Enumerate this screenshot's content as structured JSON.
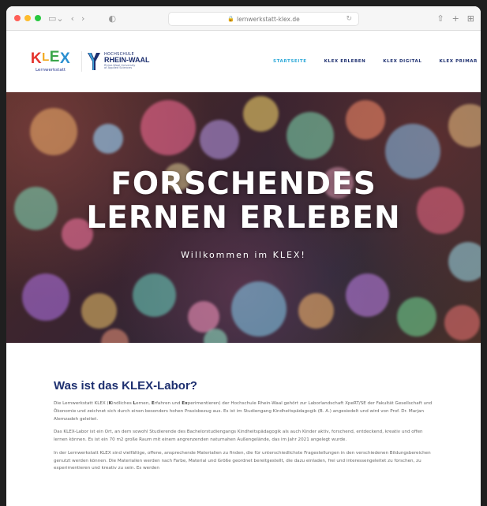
{
  "browser": {
    "url": "lernwerkstatt-klex.de",
    "traffic_lights": [
      "#ff5f57",
      "#febc2e",
      "#28c840"
    ]
  },
  "header": {
    "klex_letters": [
      {
        "ch": "K",
        "color": "#e4332c"
      },
      {
        "ch": "L",
        "color": "#f2a81d"
      },
      {
        "ch": "E",
        "color": "#3aa64a"
      },
      {
        "ch": "X",
        "color": "#2a8fd0"
      }
    ],
    "klex_subtitle": "Lernwerkstatt",
    "hsrw_line1": "HOCHSCHULE",
    "hsrw_line2": "RHEIN-WAAL",
    "hsrw_line3": "Rhine-Waal University",
    "hsrw_line4": "of Applied Sciences",
    "nav": [
      {
        "label": "STARTSEITE",
        "active": true
      },
      {
        "label": "KLEX ERLEBEN",
        "active": false
      },
      {
        "label": "KLEX DIGITAL",
        "active": false
      },
      {
        "label": "KLEX PRIMAR",
        "active": false
      }
    ]
  },
  "hero": {
    "title_line1": "FORSCHENDES",
    "title_line2": "LERNEN ERLEBEN",
    "subtitle": "Willkommen im KLEX!"
  },
  "content": {
    "heading": "Was ist das KLEX-Labor?",
    "p1": {
      "t1": "Die Lernwerkstatt KLEX (",
      "k": "K",
      "t2": "indliches ",
      "l": "L",
      "t3": "ernen, ",
      "e": "E",
      "t4": "rfahren und ",
      "ex": "Ex",
      "t5": "perimentieren) der Hochschule Rhein-Waal gehört zur Laborlandschaft XpeRT/SE der Fakultät Gesellschaft und Ökonomie und zeichnet sich durch einen besonders hohen Praxisbezug aus. Es ist im Studiengang Kindheitspädagogik (B. A.) angesiedelt und wird von Prof. Dr. Marjan Alemzadeh geleitet."
    },
    "p2": "Das KLEX-Labor ist ein Ort, an dem sowohl Studierende des Bachelorstudiengangs Kindheitspädagogik als auch Kinder aktiv, forschend, entdeckend, kreativ und offen lernen können. Es ist ein 70 m2 große Raum mit einem angrenzenden naturnahen Außengelände, das im Jahr 2021 angelegt wurde.",
    "p3": "In der Lernwerkstatt KLEX sind vielfältige, offene, ansprechende Materialien zu finden, die für unterschiedlichste Fragestellungen in den verschiedenen Bildungsbereichen genutzt werden können. Die Materialien werden nach Farbe, Material und Größe geordnet bereitgestellt, die dazu einladen, frei und interessengeleitet zu forschen, zu experimentieren und kreativ zu sein. Es werden"
  }
}
